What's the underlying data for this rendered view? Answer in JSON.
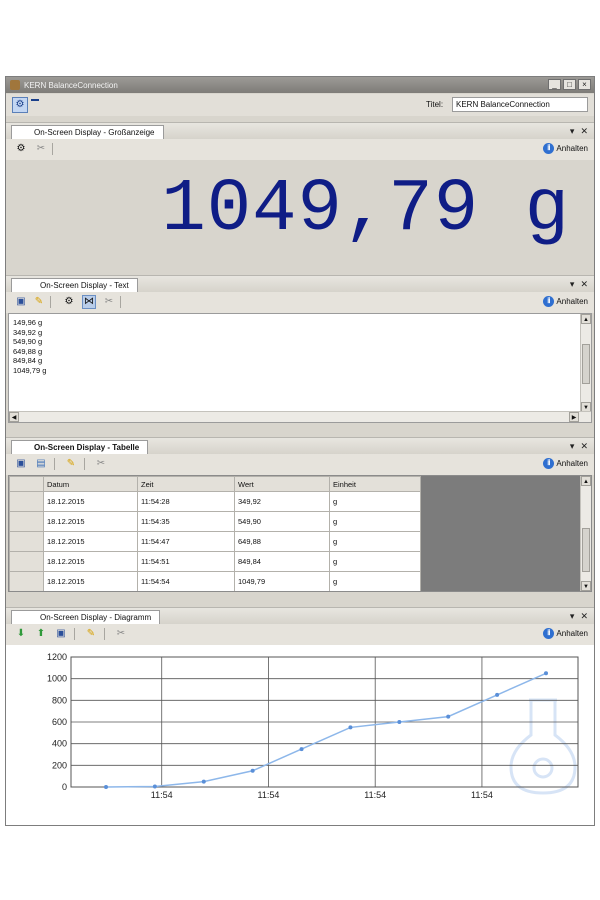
{
  "window": {
    "title": "KERN BalanceConnection",
    "buttons": [
      "_",
      "□",
      "×"
    ],
    "titel_label": "Titel:",
    "titel_value": "KERN BalanceConnection"
  },
  "panels": {
    "big": {
      "tab": "On-Screen Display - Großanzeige",
      "action": "Anhalten",
      "value": "1049,79 g"
    },
    "text": {
      "tab": "On-Screen Display - Text",
      "action": "Anhalten",
      "lines": [
        "149,96 g",
        "349,92 g",
        "549,90 g",
        "649,88 g",
        "849,84 g",
        "1049,79 g"
      ]
    },
    "table": {
      "tab": "On-Screen Display - Tabelle",
      "action": "Anhalten",
      "columns": [
        "Datum",
        "Zeit",
        "Wert",
        "Einheit"
      ],
      "rows": [
        [
          "18.12.2015",
          "11:54:28",
          "349,92",
          "g"
        ],
        [
          "18.12.2015",
          "11:54:35",
          "549,90",
          "g"
        ],
        [
          "18.12.2015",
          "11:54:47",
          "649,88",
          "g"
        ],
        [
          "18.12.2015",
          "11:54:51",
          "849,84",
          "g"
        ],
        [
          "18.12.2015",
          "11:54:54",
          "1049,79",
          "g"
        ]
      ]
    },
    "chart": {
      "tab": "On-Screen Display - Diagramm",
      "action": "Anhalten"
    }
  },
  "chart_data": {
    "type": "line",
    "title": "",
    "xlabel": "",
    "ylabel": "",
    "ylim": [
      0,
      1200
    ],
    "yticks": [
      0,
      200,
      400,
      600,
      800,
      1000,
      1200
    ],
    "xticks": [
      "11:54",
      "11:54",
      "11:54",
      "11:54"
    ],
    "grid": true,
    "legend": "none",
    "series": [
      {
        "values": [
          0,
          5,
          50,
          150,
          349.92,
          549.9,
          600,
          649.88,
          849.84,
          1049.79
        ],
        "color": "#8db7ea"
      }
    ]
  },
  "colors": {
    "display_text": "#0f1d86",
    "chart_line": "#8db7ea",
    "window_bg": "#d8d5cd"
  }
}
